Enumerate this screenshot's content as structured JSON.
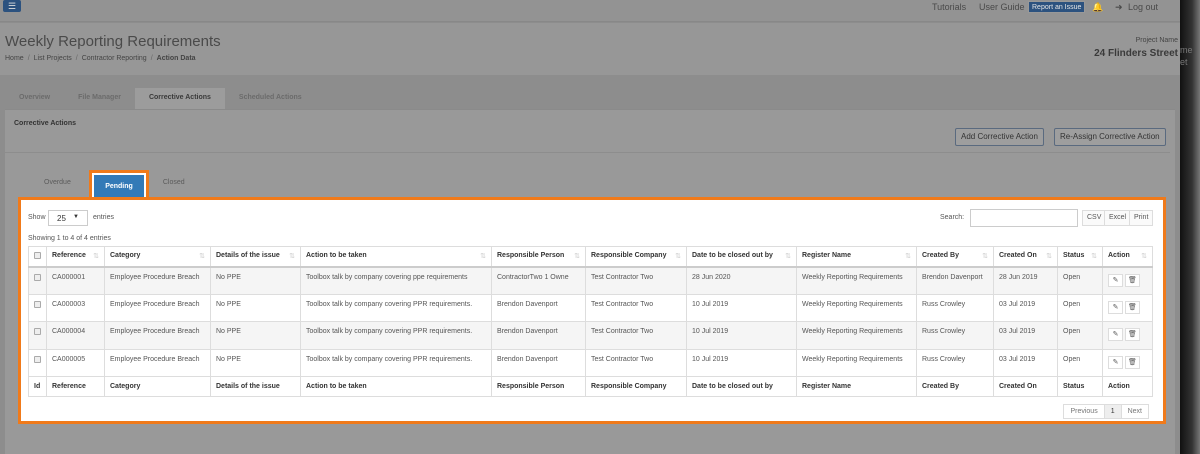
{
  "topbar": {
    "tutorials": "Tutorials",
    "user_guide": "User Guide",
    "report": "Report an Issue",
    "logout": "Log out"
  },
  "header": {
    "title": "Weekly Reporting Requirements",
    "breadcrumb": [
      "Home",
      "List Projects",
      "Contractor Reporting",
      "Action Data"
    ],
    "project_label": "Project Name",
    "project_value": "24 Flinders Street",
    "ghost": [
      "me",
      "et"
    ]
  },
  "tabs": [
    "Overview",
    "File Manager",
    "Corrective Actions",
    "Scheduled Actions"
  ],
  "panel": {
    "title": "Corrective Actions",
    "add": "Add Corrective Action",
    "reassign": "Re-Assign Corrective Action"
  },
  "subtabs": [
    "Overdue",
    "Pending",
    "Closed"
  ],
  "table_ctrl": {
    "show": "Show",
    "length": "25",
    "entries": "entries",
    "search": "Search:",
    "csv": "CSV",
    "excel": "Excel",
    "print": "Print",
    "info": "Showing 1 to 4 of 4 entries"
  },
  "columns": [
    "Reference",
    "Category",
    "Details of the issue",
    "Action to be taken",
    "Responsible Person",
    "Responsible Company",
    "Date to be closed out by",
    "Register Name",
    "Created By",
    "Created On",
    "Status",
    "Action"
  ],
  "footer_id": "Id",
  "rows": [
    [
      "CA000001",
      "Employee Procedure Breach",
      "No PPE",
      "Toolbox talk by company covering ppe requirements",
      "ContractorTwo 1 Owne",
      "Test Contractor Two",
      "28 Jun 2020",
      "Weekly Reporting Requirements",
      "Brendon Davenport",
      "28 Jun 2019",
      "Open"
    ],
    [
      "CA000003",
      "Employee Procedure Breach",
      "No PPE",
      "Toolbox talk by company covering PPR requirements.",
      "Brendon Davenport",
      "Test Contractor Two",
      "10 Jul 2019",
      "Weekly Reporting Requirements",
      "Russ Crowley",
      "03 Jul 2019",
      "Open"
    ],
    [
      "CA000004",
      "Employee Procedure Breach",
      "No PPE",
      "Toolbox talk by company covering PPR requirements.",
      "Brendon Davenport",
      "Test Contractor Two",
      "10 Jul 2019",
      "Weekly Reporting Requirements",
      "Russ Crowley",
      "03 Jul 2019",
      "Open"
    ],
    [
      "CA000005",
      "Employee Procedure Breach",
      "No PPE",
      "Toolbox talk by company covering PPR requirements.",
      "Brendon Davenport",
      "Test Contractor Two",
      "10 Jul 2019",
      "Weekly Reporting Requirements",
      "Russ Crowley",
      "03 Jul 2019",
      "Open"
    ]
  ],
  "pager": {
    "prev": "Previous",
    "page": "1",
    "next": "Next"
  }
}
